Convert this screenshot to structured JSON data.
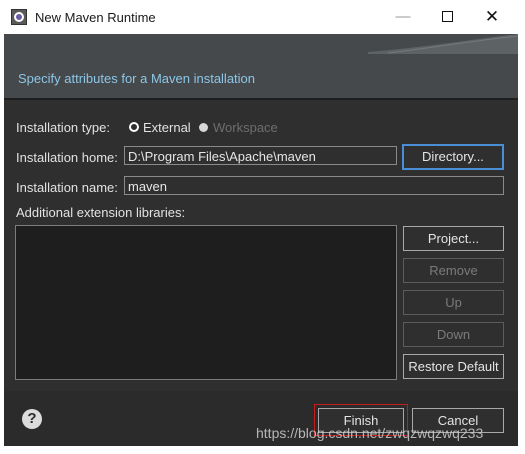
{
  "window": {
    "title": "New Maven Runtime",
    "minimize_icon": "minimize-icon",
    "maximize_icon": "maximize-icon",
    "close_icon": "close-icon",
    "minimize_glyph": "—",
    "maximize_glyph": "☐",
    "close_glyph": "✕"
  },
  "banner": {
    "message": "Specify attributes for a Maven installation"
  },
  "form": {
    "installation_type_label": "Installation type:",
    "type_options": [
      {
        "label": "External",
        "selected": true,
        "enabled": true
      },
      {
        "label": "Workspace",
        "selected": false,
        "enabled": false
      }
    ],
    "installation_home_label": "Installation home:",
    "installation_home_value": "D:\\Program Files\\Apache\\maven",
    "installation_name_label": "Installation name:",
    "installation_name_value": "maven",
    "extension_libraries_label": "Additional extension libraries:"
  },
  "buttons": {
    "directory": "Directory...",
    "project": "Project...",
    "remove": "Remove",
    "up": "Up",
    "down": "Down",
    "restore_default": "Restore Default",
    "finish": "Finish",
    "cancel": "Cancel"
  },
  "footer": {
    "help_glyph": "?"
  },
  "watermark": "https://blog.csdn.net/zwqzwqzwq233",
  "colors": {
    "dialog_bg": "#2f2f2f",
    "banner_bg": "#46494b",
    "banner_text": "#8cc6e8",
    "focus_border": "#4a8fd6",
    "highlight_border": "#c41c1c"
  }
}
